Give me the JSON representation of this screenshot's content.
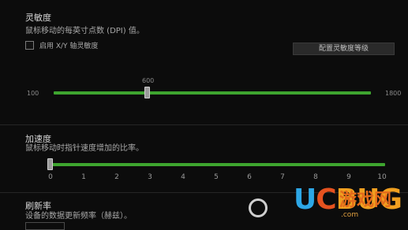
{
  "sensitivity": {
    "title": "灵敏度",
    "description": "鼠标移动的每英寸点数 (DPI) 值。",
    "enable_xy_label": "启用 X/Y 轴灵敏度",
    "configure_button": "配置灵敏度等级",
    "slider": {
      "min_label": "100",
      "max_label": "1800",
      "value_label": "600",
      "value": 600,
      "min": 100,
      "max": 1800
    }
  },
  "acceleration": {
    "title": "加速度",
    "description": "鼠标移动时指针速度增加的比率。",
    "slider": {
      "value": 0,
      "min": 0,
      "max": 10
    },
    "ticks": [
      "0",
      "1",
      "2",
      "3",
      "4",
      "5",
      "6",
      "7",
      "8",
      "9",
      "10"
    ]
  },
  "polling": {
    "title": "刷新率",
    "description": "设备的数据更新频率（赫兹）。"
  },
  "watermark": {
    "brand_u": "U",
    "brand_c": "C",
    "brand_bug": "BUG",
    "brand_cn": "游戏网",
    "url": ".com"
  },
  "colors": {
    "track": "#3ea52f",
    "background": "#0c0c0c"
  }
}
